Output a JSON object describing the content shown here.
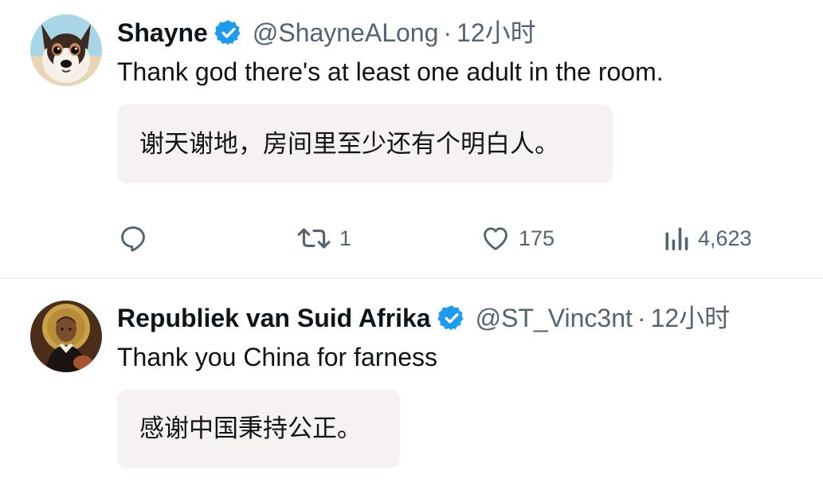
{
  "tweets": [
    {
      "display_name": "Shayne",
      "handle": "@ShayneALong",
      "separator": "·",
      "time": "12小时",
      "text": "Thank god there's at least one adult in the room.",
      "translation": "谢天谢地，房间里至少还有个明白人。",
      "avatar": "dog-avatar",
      "actions": {
        "reply_count": "",
        "retweet_count": "1",
        "like_count": "175",
        "views_count": "4,623"
      }
    },
    {
      "display_name": "Republiek van Suid Afrika",
      "handle": "@ST_Vinc3nt",
      "separator": "·",
      "time": "12小时",
      "text": "Thank you China for farness",
      "translation": "感谢中国秉持公正。",
      "avatar": "saint-portrait-avatar"
    }
  ],
  "colors": {
    "text_primary": "#0f1419",
    "text_secondary": "#536471",
    "verified_blue": "#1d9bf0",
    "translation_bg": "#f7f2f2",
    "divider": "#eff3f4"
  },
  "icons": {
    "verified": "verified-badge-icon",
    "reply": "reply-icon",
    "retweet": "retweet-icon",
    "like": "heart-icon",
    "views": "views-bar-chart-icon"
  }
}
